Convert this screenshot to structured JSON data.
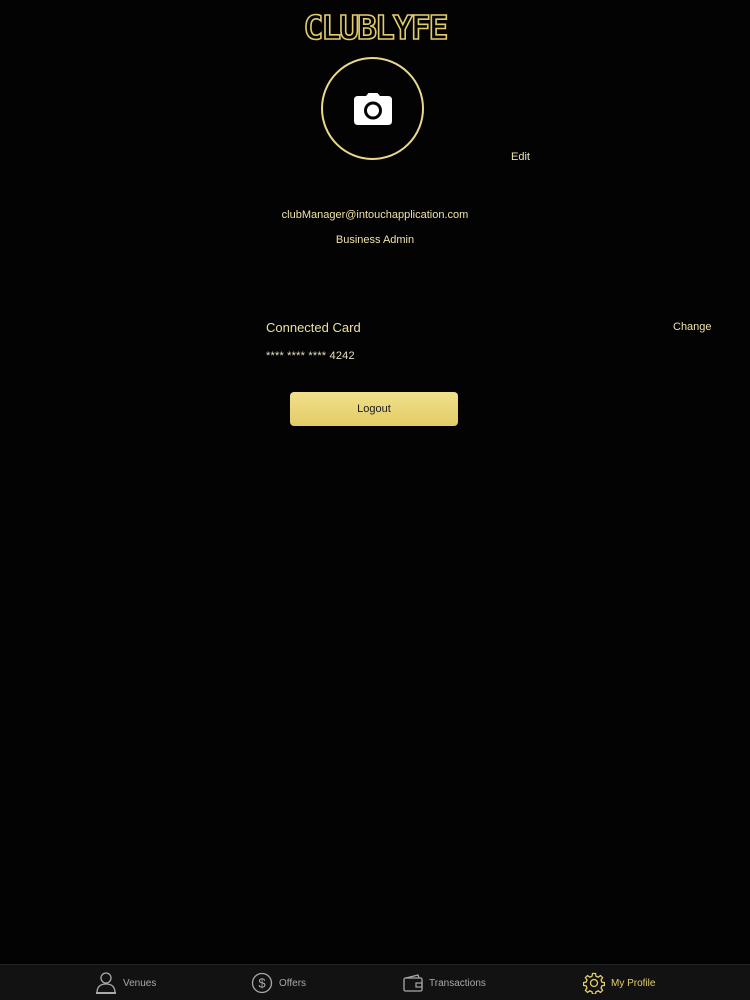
{
  "app": {
    "logo_text": "CLUBLYFE"
  },
  "profile": {
    "edit_label": "Edit",
    "email": "clubManager@intouchapplication.com",
    "role": "Business Admin"
  },
  "card": {
    "title": "Connected Card",
    "change_label": "Change",
    "number": "**** **** **** 4242"
  },
  "actions": {
    "logout_label": "Logout"
  },
  "tabs": [
    {
      "label": "Venues",
      "icon": "person-user-icon",
      "active": false
    },
    {
      "label": "Offers",
      "icon": "dollar-circle-icon",
      "active": false
    },
    {
      "label": "Transactions",
      "icon": "wallet-icon",
      "active": false
    },
    {
      "label": "My Profile",
      "icon": "gear-icon",
      "active": true
    }
  ],
  "colors": {
    "accent": "#e3cf6e",
    "text": "#efe3a6",
    "background": "#030303",
    "tab_bar": "#121212"
  }
}
